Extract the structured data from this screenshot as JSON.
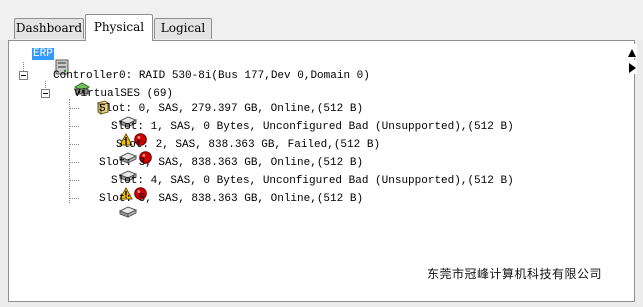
{
  "tabs": [
    {
      "label": "Dashboard"
    },
    {
      "label": "Physical"
    },
    {
      "label": "Logical"
    }
  ],
  "active_tab": "Physical",
  "tree": {
    "root": {
      "label": "ERP",
      "icon": "server-icon"
    },
    "controller": {
      "label": "Controller0: RAID 530-8i(Bus 177,Dev 0,Domain 0)",
      "icon": "controller-icon"
    },
    "enclosure": {
      "label": "VirtualSES (69)",
      "icon": "enclosure-icon"
    },
    "drives": [
      {
        "label": "Slot: 0, SAS, 279.397 GB, Online,(512 B)",
        "status": "ok"
      },
      {
        "label": "Slot: 1, SAS, 0 Bytes, Unconfigured Bad (Unsupported),(512 B)",
        "status": "bad"
      },
      {
        "label": "Slot: 2, SAS, 838.363 GB, Failed,(512 B)",
        "status": "failed"
      },
      {
        "label": "Slot: 3, SAS, 838.363 GB, Online,(512 B)",
        "status": "ok"
      },
      {
        "label": "Slot: 4, SAS, 0 Bytes, Unconfigured Bad (Unsupported),(512 B)",
        "status": "bad"
      },
      {
        "label": "Slot: 5, SAS, 838.363 GB, Online,(512 B)",
        "status": "ok"
      }
    ]
  },
  "watermark": "东莞市冠峰计算机科技有限公司",
  "colors": {
    "selection": "#3399ff",
    "error": "#cc0000",
    "warning": "#f2c200"
  }
}
